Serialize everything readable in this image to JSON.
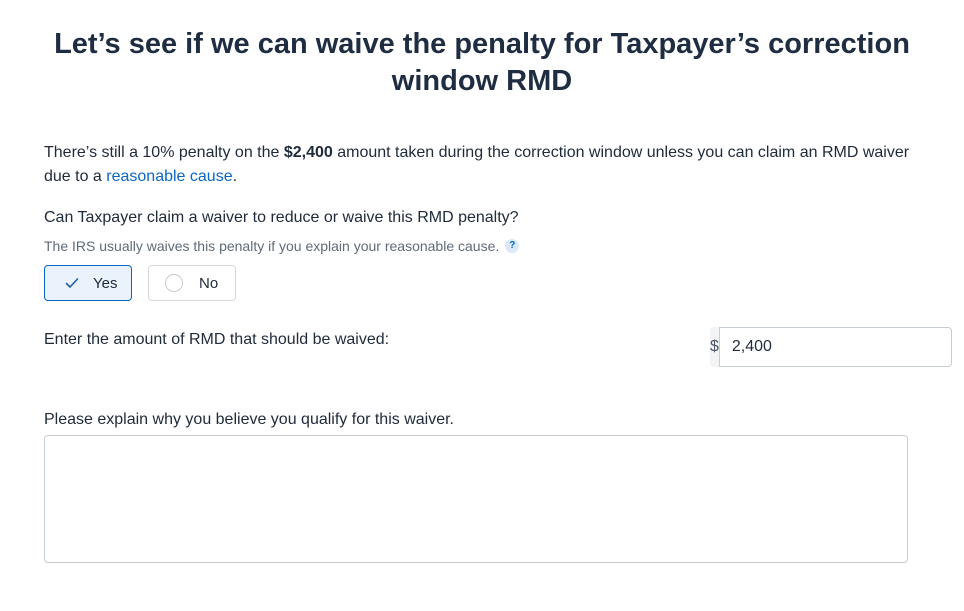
{
  "page": {
    "title": "Let’s see if we can waive the penalty for Taxpayer’s correction window RMD"
  },
  "intro": {
    "text_before_amount": "There’s still a 10% penalty on the ",
    "amount": "$2,400",
    "text_after_amount": " amount taken during the correction window unless you can claim an RMD waiver due to a ",
    "link_text": "reasonable cause",
    "text_end": "."
  },
  "waiver_question": {
    "label": "Can Taxpayer claim a waiver to reduce or waive this RMD penalty?",
    "help_text": "The IRS usually waives this penalty if you explain your reasonable cause.",
    "help_icon": "?",
    "options": [
      {
        "label": "Yes",
        "selected": true,
        "icon": "check-icon"
      },
      {
        "label": "No",
        "selected": false,
        "icon": "radio-icon"
      }
    ]
  },
  "amount_field": {
    "label": "Enter the amount of RMD that should be waived:",
    "prefix": "$",
    "value": "2,400"
  },
  "explanation_field": {
    "label": "Please explain why you believe you qualify for this waiver.",
    "value": ""
  },
  "colors": {
    "accent": "#0b66c3",
    "selected_background": "#eaf3fc",
    "heading": "#1f2d42",
    "muted_text": "#5f6b7a",
    "border": "#c6ccd3"
  }
}
